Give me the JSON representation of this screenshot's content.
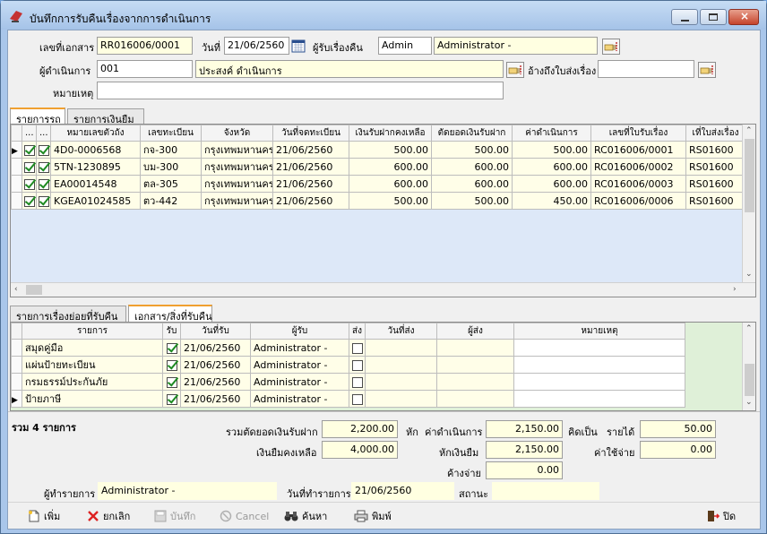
{
  "window": {
    "title": "บันทึกการรับคืนเรื่องจากการดำเนินการ"
  },
  "header": {
    "doc_no_label": "เลขที่เอกสาร",
    "doc_no": "RR016006/0001",
    "date_label": "วันที่",
    "date": "21/06/2560",
    "receiver_label": "ผู้รับเรื่องคืน",
    "receiver_code": "Admin",
    "receiver_name": "Administrator -",
    "operator_label": "ผู้ดำเนินการ",
    "operator_code": "001",
    "operator_name": "ประสงค์ ดำเนินการ",
    "ref_label": "อ้างถึงใบส่งเรื่อง",
    "ref_value": "",
    "note_label": "หมายเหตุ",
    "note_value": ""
  },
  "top_tabs": [
    "รายการรถ",
    "รายการเงินยืม"
  ],
  "vehicle_grid": {
    "columns": [
      "...",
      "...",
      "หมายเลขตัวถัง",
      "เลขทะเบียน",
      "จังหวัด",
      "วันที่จดทะเบียน",
      "เงินรับฝากคงเหลือ",
      "ตัดยอดเงินรับฝาก",
      "ค่าดำเนินการ",
      "เลขที่ใบรับเรื่อง",
      "เที่ใบส่งเรื่อง"
    ],
    "rows": [
      {
        "c1": true,
        "c2": true,
        "chassis": "4D0-0006568",
        "plate": "กจ-300",
        "province": "กรุงเทพมหานคร",
        "reg_date": "21/06/2560",
        "deposit": "500.00",
        "cut": "500.00",
        "fee": "500.00",
        "recv_no": "RC016006/0001",
        "send_no": "RS01600"
      },
      {
        "c1": true,
        "c2": true,
        "chassis": "5TN-1230895",
        "plate": "บม-300",
        "province": "กรุงเทพมหานคร",
        "reg_date": "21/06/2560",
        "deposit": "600.00",
        "cut": "600.00",
        "fee": "600.00",
        "recv_no": "RC016006/0002",
        "send_no": "RS01600"
      },
      {
        "c1": true,
        "c2": true,
        "chassis": "EA00014548",
        "plate": "ตล-305",
        "province": "กรุงเทพมหานคร",
        "reg_date": "21/06/2560",
        "deposit": "600.00",
        "cut": "600.00",
        "fee": "600.00",
        "recv_no": "RC016006/0003",
        "send_no": "RS01600"
      },
      {
        "c1": true,
        "c2": true,
        "chassis": "KGEA01024585",
        "plate": "ตว-442",
        "province": "กรุงเทพมหานคร",
        "reg_date": "21/06/2560",
        "deposit": "500.00",
        "cut": "500.00",
        "fee": "450.00",
        "recv_no": "RC016006/0006",
        "send_no": "RS01600"
      }
    ]
  },
  "bottom_tabs": [
    "รายการเรื่องย่อยที่รับคืน",
    "เอกสาร/สิ่งที่รับคืน"
  ],
  "doc_grid": {
    "columns": [
      "รายการ",
      "รับ",
      "วันที่รับ",
      "ผู้รับ",
      "ส่ง",
      "วันที่ส่ง",
      "ผู้ส่ง",
      "หมายเหตุ"
    ],
    "rows": [
      {
        "item": "สมุดคู่มือ",
        "recv": true,
        "recv_date": "21/06/2560",
        "recv_by": "Administrator -",
        "sent": false
      },
      {
        "item": "แผ่นป้ายทะเบียน",
        "recv": true,
        "recv_date": "21/06/2560",
        "recv_by": "Administrator -",
        "sent": false
      },
      {
        "item": "กรมธรรม์ประกันภัย",
        "recv": true,
        "recv_date": "21/06/2560",
        "recv_by": "Administrator -",
        "sent": false
      },
      {
        "item": "ป้ายภาษี",
        "recv": true,
        "recv_date": "21/06/2560",
        "recv_by": "Administrator -",
        "sent": false
      }
    ]
  },
  "summary": {
    "total_label": "รวม 4 รายการ",
    "cut_total_label": "รวมตัดยอดเงินรับฝาก",
    "cut_total": "2,200.00",
    "deduct_label": "หัก",
    "fee_label": "ค่าดำเนินการ",
    "fee_total": "2,150.00",
    "as_label": "คิดเป็น",
    "income_label": "รายได้",
    "income": "50.00",
    "borrow_label": "เงินยืมคงเหลือ",
    "borrow": "4,000.00",
    "deduct_borrow_label": "หักเงินยืม",
    "deduct_borrow": "2,150.00",
    "expense_label": "ค่าใช้จ่าย",
    "expense": "0.00",
    "pending_label": "ค้างจ่าย",
    "pending": "0.00"
  },
  "status": {
    "maker_label": "ผู้ทำรายการ",
    "maker": "Administrator -",
    "made_date_label": "วันที่ทำรายการ",
    "made_date": "21/06/2560",
    "state_label": "สถานะ",
    "state": ""
  },
  "toolbar": {
    "add": "เพิ่ม",
    "cancel_th": "ยกเลิก",
    "save": "บันทึก",
    "cancel": "Cancel",
    "search": "ค้นหา",
    "print": "พิมพ์",
    "close": "ปิด"
  },
  "colors": {
    "accent_tab": "#f0a030",
    "input_yellow": "#ffffe1",
    "grid_blue": "#dde8f8",
    "grid_green": "#dff0d8"
  }
}
